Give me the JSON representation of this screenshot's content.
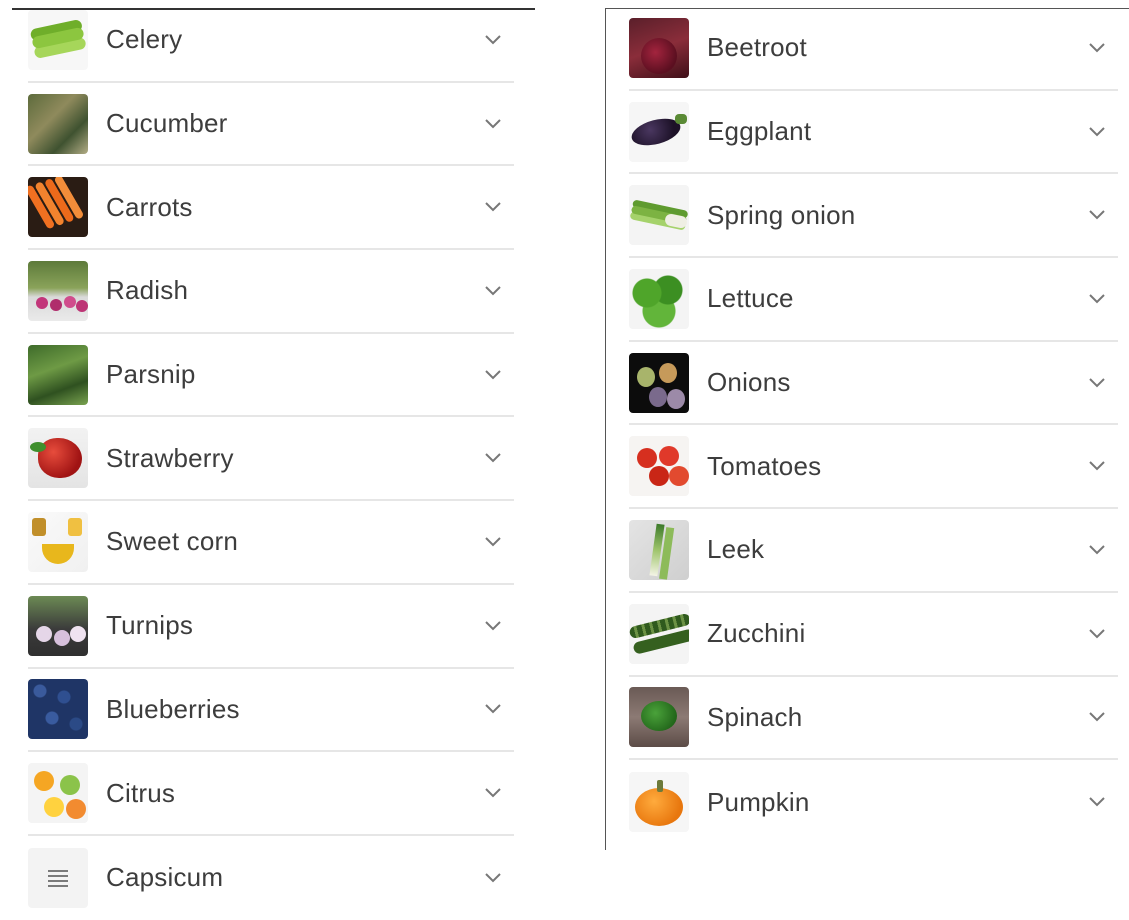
{
  "left_list": {
    "items": [
      {
        "label": "Celery",
        "thumb": "celery"
      },
      {
        "label": "Cucumber",
        "thumb": "cucumber"
      },
      {
        "label": "Carrots",
        "thumb": "carrots"
      },
      {
        "label": "Radish",
        "thumb": "radish"
      },
      {
        "label": "Parsnip",
        "thumb": "parsnip"
      },
      {
        "label": "Strawberry",
        "thumb": "strawberry"
      },
      {
        "label": "Sweet corn",
        "thumb": "sweetcorn"
      },
      {
        "label": "Turnips",
        "thumb": "turnips"
      },
      {
        "label": "Blueberries",
        "thumb": "blueberries"
      },
      {
        "label": "Citrus",
        "thumb": "citrus"
      },
      {
        "label": "Capsicum",
        "thumb": "capsicum"
      }
    ]
  },
  "right_list": {
    "items": [
      {
        "label": "Beetroot",
        "thumb": "beetroot"
      },
      {
        "label": "Eggplant",
        "thumb": "eggplant"
      },
      {
        "label": "Spring onion",
        "thumb": "springonion"
      },
      {
        "label": "Lettuce",
        "thumb": "lettuce"
      },
      {
        "label": "Onions",
        "thumb": "onions"
      },
      {
        "label": "Tomatoes",
        "thumb": "tomatoes"
      },
      {
        "label": "Leek",
        "thumb": "leek"
      },
      {
        "label": "Zucchini",
        "thumb": "zucchini"
      },
      {
        "label": "Spinach",
        "thumb": "spinach"
      },
      {
        "label": "Pumpkin",
        "thumb": "pumpkin"
      }
    ]
  },
  "icons": {
    "expand": "chevron-down-icon",
    "placeholder": "list-lines-icon"
  },
  "colors": {
    "divider": "#e6e6e6",
    "text": "#3d3d3d",
    "chevron": "#777777"
  }
}
